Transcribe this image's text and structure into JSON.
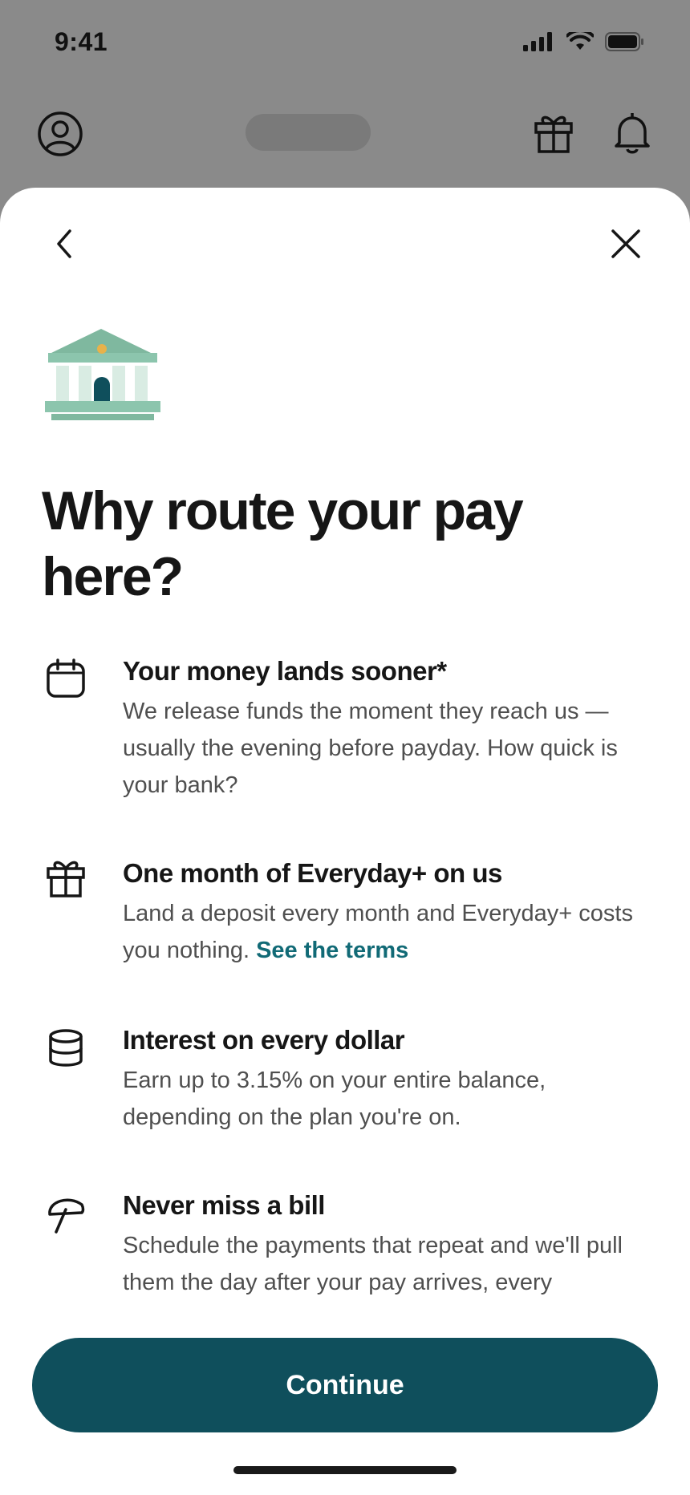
{
  "status_bar": {
    "time": "9:41"
  },
  "header": {
    "profile_icon": "person-circle-icon",
    "gift_icon": "gift-icon",
    "bell_icon": "bell-icon"
  },
  "sheet": {
    "back_icon": "chevron-left-icon",
    "close_icon": "close-icon",
    "title": "Why route your pay here?",
    "benefits": [
      {
        "icon": "calendar-icon",
        "title": "Your money lands sooner*",
        "body": "We release funds the moment they reach us — usually the evening before payday. How quick is your bank?"
      },
      {
        "icon": "gift-icon",
        "title": "One month of Everyday+ on us",
        "body": "Land a deposit every month and Everyday+ costs you nothing.",
        "link": "See the terms"
      },
      {
        "icon": "coins-stack-icon",
        "title": "Interest on every dollar",
        "body": "Earn up to 3.15% on your entire balance, depending on the plan you're on."
      },
      {
        "icon": "umbrella-icon",
        "title": "Never miss a bill",
        "body": "Schedule the payments that repeat and we'll pull them the day after your pay arrives, every"
      }
    ],
    "continue_label": "Continue"
  },
  "colors": {
    "accent": "#0f4f5c",
    "link": "#116a76",
    "illustration_green": "#8cc5ad",
    "illustration_gold": "#e8b24a"
  }
}
